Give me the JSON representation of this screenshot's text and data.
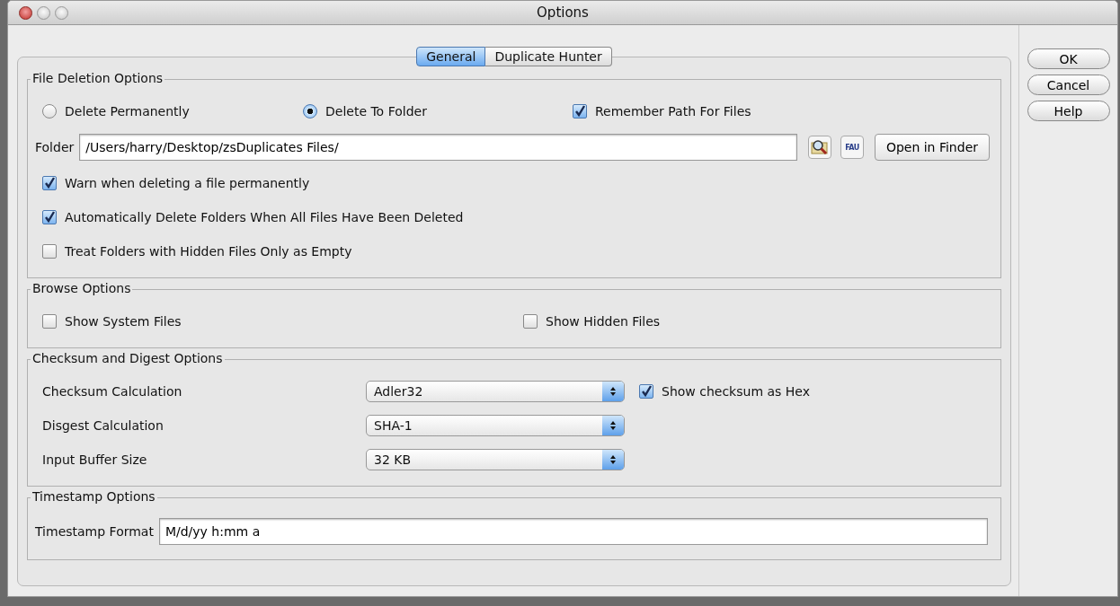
{
  "window": {
    "title": "Options"
  },
  "tabs": [
    {
      "label": "General",
      "selected": true
    },
    {
      "label": "Duplicate Hunter",
      "selected": false
    }
  ],
  "sections": [
    {
      "title": "File Deletion Options",
      "rows": [
        {
          "kind": "choices",
          "items": [
            {
              "kind": "radio",
              "label": "Delete Permanently",
              "selected": false
            },
            {
              "kind": "radio",
              "label": "Delete To Folder",
              "selected": true
            },
            {
              "kind": "checkbox",
              "label": "Remember Path For Files",
              "checked": true
            }
          ]
        },
        {
          "kind": "path",
          "label": "Folder",
          "value": "/Users/harry/Desktop/zsDuplicates Files/",
          "icon_label": "FAU",
          "button": "Open in Finder"
        },
        {
          "kind": "checkbox",
          "label": "Warn when deleting a file permanently",
          "checked": true
        },
        {
          "kind": "checkbox",
          "label": "Automatically Delete Folders When All Files Have Been Deleted",
          "checked": true
        },
        {
          "kind": "checkbox",
          "label": "Treat Folders with Hidden Files Only as Empty",
          "checked": false
        }
      ]
    },
    {
      "title": "Browse Options",
      "rows": [
        {
          "kind": "choices",
          "items": [
            {
              "kind": "checkbox",
              "label": "Show System Files",
              "checked": false
            },
            {
              "kind": "checkbox",
              "label": "Show Hidden Files",
              "checked": false
            }
          ]
        }
      ]
    },
    {
      "title": "Checksum and Digest Options",
      "rows": [
        {
          "kind": "select",
          "label": "Checksum Calculation",
          "value": "Adler32",
          "extra": {
            "label": "Show checksum as Hex",
            "checked": true
          }
        },
        {
          "kind": "select",
          "label": "Disgest Calculation",
          "value": "SHA-1"
        },
        {
          "kind": "select",
          "label": "Input Buffer Size",
          "value": "32 KB"
        }
      ]
    },
    {
      "title": "Timestamp Options",
      "rows": [
        {
          "kind": "field",
          "label": "Timestamp Format",
          "value": "M/d/yy h:mm a"
        }
      ]
    }
  ],
  "buttons": [
    {
      "label": "OK"
    },
    {
      "label": "Cancel"
    },
    {
      "label": "Help"
    }
  ]
}
